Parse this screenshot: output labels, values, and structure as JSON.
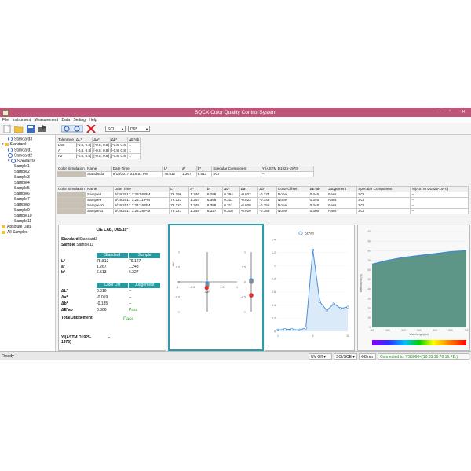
{
  "window": {
    "title": "SQCX Color Quality Control System",
    "controls": [
      "—",
      "▫",
      "✕"
    ]
  },
  "menu": [
    "File",
    "Instrument",
    "Measurement",
    "Data",
    "Setting",
    "Help"
  ],
  "toolbar": {
    "mode": "SCI",
    "illuminant": "D65"
  },
  "tree": {
    "items": [
      {
        "label": "Standard3",
        "level": 1,
        "icon": "target-icon",
        "expand": ""
      },
      {
        "label": "Standard",
        "level": 0,
        "icon": "folder-icon",
        "expand": "▾"
      },
      {
        "label": "Standard1",
        "level": 1,
        "icon": "target-icon",
        "expand": ""
      },
      {
        "label": "Standard2",
        "level": 1,
        "icon": "target-icon",
        "expand": ""
      },
      {
        "label": "Standard3",
        "level": 1,
        "icon": "target-icon",
        "expand": "▾"
      },
      {
        "label": "Sample1",
        "level": 2,
        "icon": "",
        "expand": ""
      },
      {
        "label": "Sample2",
        "level": 2,
        "icon": "",
        "expand": ""
      },
      {
        "label": "Sample3",
        "level": 2,
        "icon": "",
        "expand": ""
      },
      {
        "label": "Sample4",
        "level": 2,
        "icon": "",
        "expand": ""
      },
      {
        "label": "Sample5",
        "level": 2,
        "icon": "",
        "expand": ""
      },
      {
        "label": "Sample6",
        "level": 2,
        "icon": "",
        "expand": ""
      },
      {
        "label": "Sample7",
        "level": 2,
        "icon": "",
        "expand": ""
      },
      {
        "label": "Sample8",
        "level": 2,
        "icon": "",
        "expand": ""
      },
      {
        "label": "Sample9",
        "level": 2,
        "icon": "",
        "expand": ""
      },
      {
        "label": "Sample10",
        "level": 2,
        "icon": "",
        "expand": ""
      },
      {
        "label": "Sample11",
        "level": 2,
        "icon": "",
        "expand": ""
      },
      {
        "label": "Absolute Data",
        "level": 0,
        "icon": "folder-icon",
        "expand": ""
      },
      {
        "label": "All Samples",
        "level": 0,
        "icon": "folder-icon",
        "expand": ""
      }
    ]
  },
  "tolerance": {
    "headers": [
      "Tolerance",
      "ΔL*",
      "Δa*",
      "Δb*",
      "ΔE*ab"
    ],
    "rows": [
      [
        "D65",
        "[-0.8, 0.8]",
        "[-0.8, 0.8]",
        "[-0.8, 0.8]",
        "1"
      ],
      [
        "A",
        "[-0.8, 0.8]",
        "[-0.8, 0.8]",
        "[-0.8, 0.8]",
        "1"
      ],
      [
        "F2",
        "[-0.8, 0.8]",
        "[-0.8, 0.8]",
        "[-0.8, 0.8]",
        "1"
      ]
    ]
  },
  "standard_table": {
    "headers": [
      "Color Simulation",
      "Name",
      "Date Time",
      "L*",
      "a*",
      "b*",
      "Specular Component",
      "YI(ASTM D1925-1970)"
    ],
    "row": [
      "",
      "Standard3",
      "9/19/2017 3:19:51 PM",
      "78.812",
      "1.267",
      "6.513",
      "SCI",
      "--"
    ]
  },
  "sample_table": {
    "headers": [
      "Color Simulation",
      "Name",
      "Date Time",
      "L*",
      "a*",
      "b*",
      "ΔL*",
      "Δa*",
      "Δb*",
      "Color Offset",
      "ΔE*ab",
      "Judgement",
      "Specular Component",
      "YI(ASTM D1925-1970)"
    ],
    "rows": [
      [
        "",
        "Sample8",
        "9/19/2017 3:23:56 PM",
        "79.196",
        "1.246",
        "6.288",
        "0.384",
        "-0.022",
        "-0.224",
        "None",
        "0.446",
        "Pass",
        "SCI",
        "--"
      ],
      [
        "",
        "Sample9",
        "9/19/2017 3:24:11 PM",
        "79.123",
        "1.244",
        "6.365",
        "0.311",
        "-0.023",
        "-0.148",
        "None",
        "0.346",
        "Pass",
        "SCI",
        "--"
      ],
      [
        "",
        "Sample10",
        "9/19/2017 3:24:16 PM",
        "79.122",
        "1.248",
        "6.358",
        "0.311",
        "-0.020",
        "-0.155",
        "None",
        "0.348",
        "Pass",
        "SCI",
        "--"
      ],
      [
        "",
        "Sample11",
        "9/19/2017 3:24:28 PM",
        "79.127",
        "1.248",
        "6.327",
        "0.316",
        "-0.019",
        "-0.185",
        "None",
        "0.366",
        "Pass",
        "SCI",
        "--"
      ]
    ]
  },
  "cie_panel": {
    "title": "CIE LAB, D65/10°",
    "standard_label": "Standard",
    "standard_value": "Standard3",
    "sample_label": "Sample",
    "sample_value": "Sample11",
    "col_std": "Standard",
    "col_smp": "Sample",
    "values": [
      {
        "label": "L*",
        "std": "78.812",
        "smp": "79.127"
      },
      {
        "label": "a*",
        "std": "1.267",
        "smp": "1.248"
      },
      {
        "label": "b*",
        "std": "6.513",
        "smp": "6.327"
      }
    ],
    "col_diff": "Color Diff",
    "col_judge": "Judgement",
    "diffs": [
      {
        "label": "ΔL*",
        "val": "0.316",
        "judge": "--"
      },
      {
        "label": "Δa*",
        "val": "-0.019",
        "judge": "--"
      },
      {
        "label": "Δb*",
        "val": "-0.185",
        "judge": "--"
      },
      {
        "label": "ΔE*ab",
        "val": "0.366",
        "judge": "Pass"
      }
    ],
    "total_label": "Total Judgement",
    "total_value": "Pass",
    "yi_label": "YI(ASTM D1925-1970)",
    "yi_value": "--"
  },
  "chart_data": [
    {
      "type": "scatter",
      "title": "",
      "x_ticks": [
        "-1",
        "-0.5",
        "0",
        "0.5",
        "1"
      ],
      "y_ticks": [
        "1",
        "0.5",
        "0",
        "-0.5",
        "-1"
      ],
      "xlabel": "Δa*",
      "ylabel": "Δb*",
      "xlim": [
        -1,
        1
      ],
      "ylim": [
        -1,
        1
      ],
      "points": [
        {
          "a": 0.0,
          "b": -0.05,
          "color": "#4a90d9"
        },
        {
          "a": 0.0,
          "b": -0.12,
          "color": "#888888"
        },
        {
          "a": -0.02,
          "b": -0.2,
          "color": "#e03030"
        }
      ],
      "l_ticks": [
        "1",
        "0.5",
        "0",
        "-0.5",
        "-1"
      ],
      "l_points": [
        {
          "v": 0.05,
          "color": "#4a90d9"
        },
        {
          "v": 0.0,
          "color": "#888888"
        },
        {
          "v": -0.45,
          "color": "#e03030"
        }
      ]
    },
    {
      "type": "line",
      "legend": "ΔE*ab",
      "legend_position": "top",
      "x": [
        1,
        2,
        3,
        4,
        5,
        6,
        7,
        8,
        9,
        10,
        11
      ],
      "y": [
        0.02,
        0.03,
        0.03,
        0.02,
        0.05,
        1.24,
        0.45,
        0.32,
        0.42,
        0.35,
        0.37
      ],
      "ylim": [
        0,
        1.4
      ],
      "y_ticks": [
        "1.4",
        "1.2",
        "1",
        "0.8",
        "0.6",
        "0.4",
        "0.2",
        "0"
      ],
      "x_ticks": [
        "1",
        "6",
        "11"
      ]
    },
    {
      "type": "area",
      "title": "",
      "xlabel": "Wavelength(nm)",
      "ylabel": "Reflectance(%)",
      "x": [
        400,
        450,
        500,
        550,
        600,
        650,
        700
      ],
      "y": [
        66,
        70,
        73,
        75,
        77,
        79,
        80
      ],
      "xlim": [
        400,
        700
      ],
      "ylim": [
        0,
        100
      ],
      "x_ticks": [
        "400",
        "450",
        "500",
        "550",
        "600",
        "650",
        "700"
      ],
      "y_ticks": [
        "100",
        "90",
        "80",
        "70",
        "60",
        "50",
        "40",
        "30",
        "20",
        "10",
        "0"
      ]
    }
  ],
  "status": {
    "ready": "Ready",
    "uv": "UV Off",
    "mode": "SCI/SCE",
    "aperture": "Φ8mm",
    "connection": "Connected to: YS3060<(10:03:16:70:16:FB:)"
  },
  "colors": {
    "title_bar": "#c0557a",
    "teal": "#259ba0",
    "status_green": "#2e8b2e",
    "pass_green": "#2e9a2e"
  }
}
